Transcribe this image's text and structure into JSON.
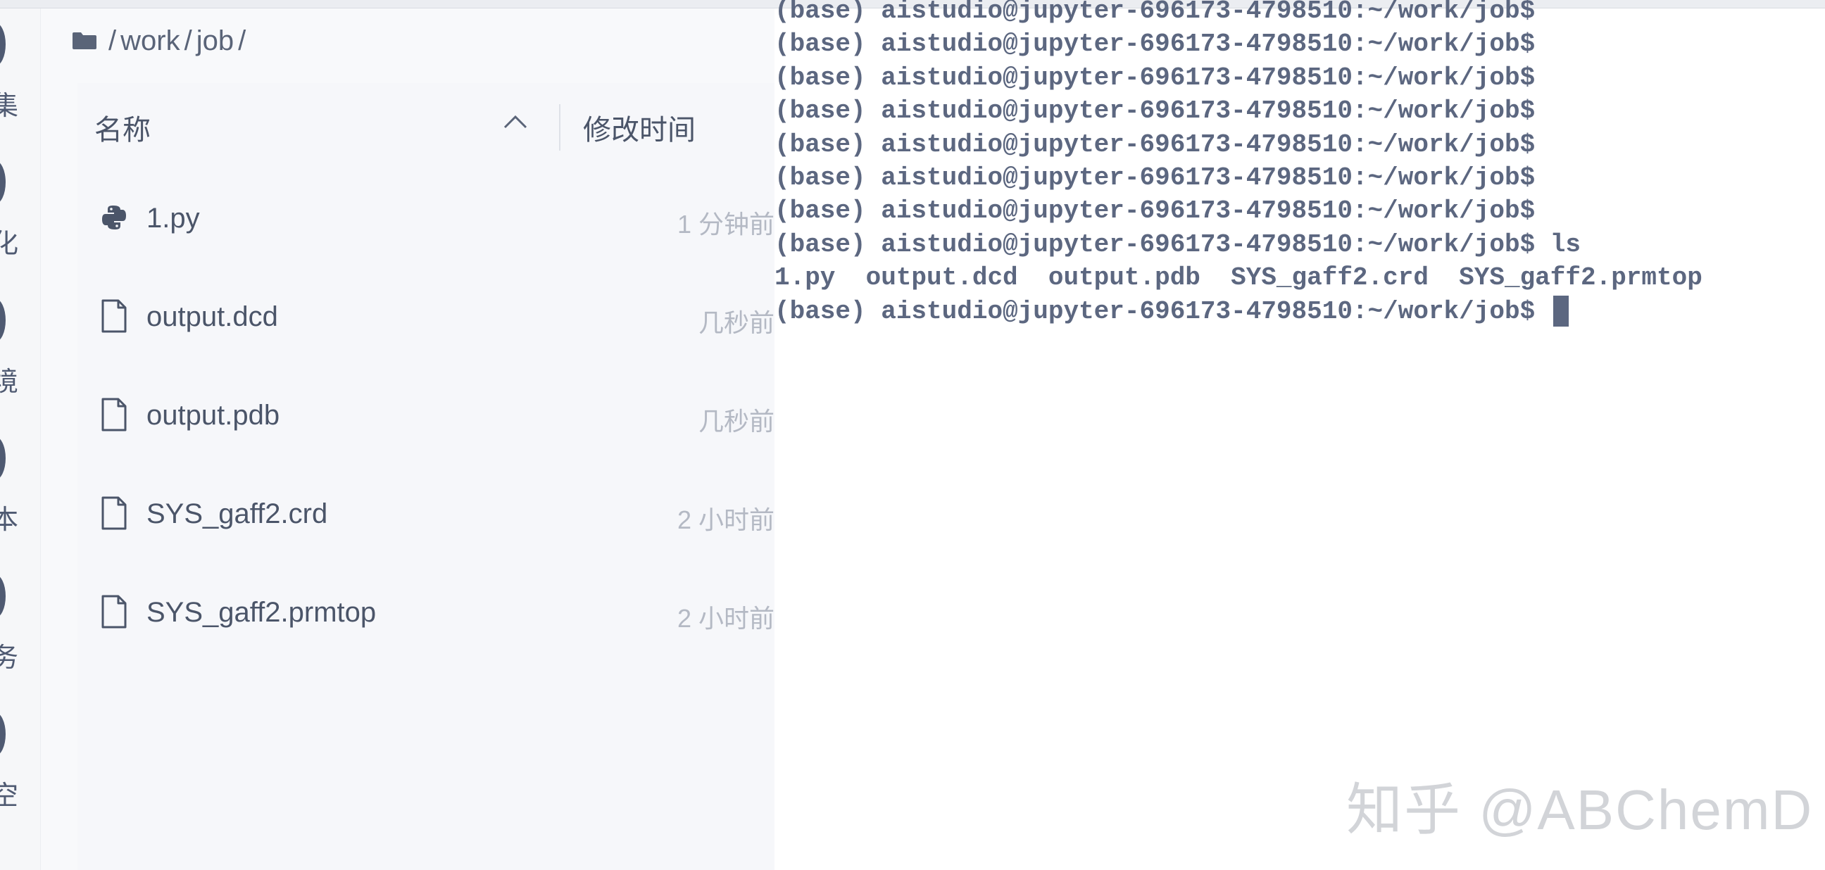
{
  "breadcrumb": {
    "items": [
      "work",
      "job"
    ]
  },
  "listing_header": {
    "name_label": "名称",
    "modified_label": "修改时间"
  },
  "sidebar": {
    "items": [
      {
        "label": "集",
        "icon": "circle-icon"
      },
      {
        "label": "化",
        "icon": "circle-icon"
      },
      {
        "label": "境",
        "icon": "circle-icon"
      },
      {
        "label": "本",
        "icon": "circle-icon"
      },
      {
        "label": "务",
        "icon": "circle-icon"
      },
      {
        "label": "空",
        "icon": "circle-icon"
      }
    ]
  },
  "files": [
    {
      "name": "1.py",
      "time": "1 分钟前",
      "icon": "python-icon"
    },
    {
      "name": "output.dcd",
      "time": "几秒前",
      "icon": "file-icon"
    },
    {
      "name": "output.pdb",
      "time": "几秒前",
      "icon": "file-icon"
    },
    {
      "name": "SYS_gaff2.crd",
      "time": "2 小时前",
      "icon": "file-icon"
    },
    {
      "name": "SYS_gaff2.prmtop",
      "time": "2 小时前",
      "icon": "file-icon"
    }
  ],
  "terminal": {
    "lines": [
      "(base) aistudio@jupyter-696173-4798510:~/work/job$",
      "(base) aistudio@jupyter-696173-4798510:~/work/job$",
      "(base) aistudio@jupyter-696173-4798510:~/work/job$",
      "(base) aistudio@jupyter-696173-4798510:~/work/job$",
      "(base) aistudio@jupyter-696173-4798510:~/work/job$",
      "(base) aistudio@jupyter-696173-4798510:~/work/job$",
      "(base) aistudio@jupyter-696173-4798510:~/work/job$",
      "(base) aistudio@jupyter-696173-4798510:~/work/job$ ls",
      "1.py  output.dcd  output.pdb  SYS_gaff2.crd  SYS_gaff2.prmtop",
      "(base) aistudio@jupyter-696173-4798510:~/work/job$ "
    ]
  },
  "watermark": "知乎 @ABChemD",
  "colors": {
    "text": "#4b5569",
    "muted": "#b4b9c4",
    "terminal_text": "#5c6780",
    "panel_bg": "#f6f7fa"
  }
}
